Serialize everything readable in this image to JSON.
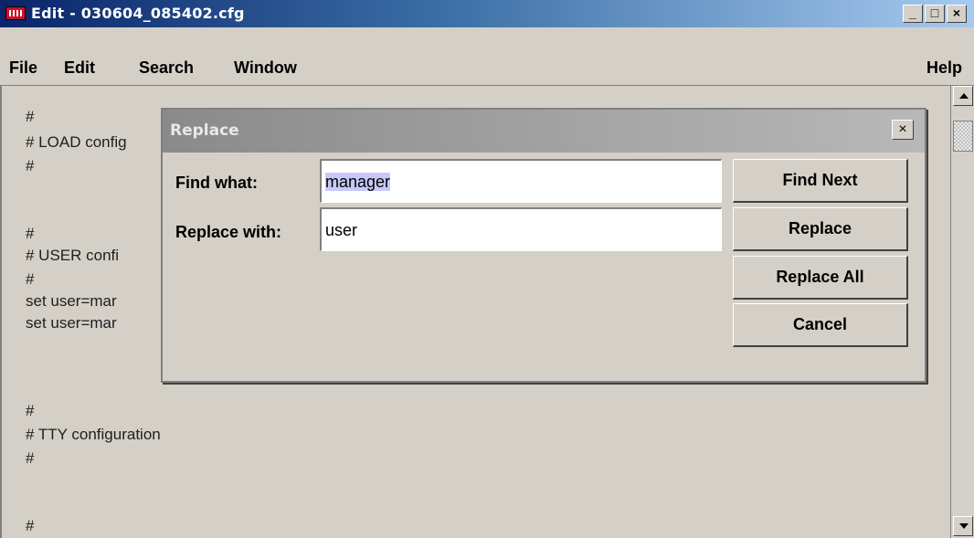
{
  "window": {
    "title": "Edit - 030604_085402.cfg",
    "minimize_label": "_",
    "maximize_label": "□",
    "close_label": "×"
  },
  "menu": {
    "file": "File",
    "edit": "Edit",
    "search": "Search",
    "window": "Window",
    "help": "Help"
  },
  "editor_lines": [
    "#",
    "# LOAD config",
    "#",
    "",
    "#",
    "# USER confi",
    "#",
    "set user=mar",
    "set user=mar",
    "",
    "#",
    "# TTY configuration",
    "#",
    "",
    "#"
  ],
  "dialog": {
    "title": "Replace",
    "close_label": "×",
    "find_label": "Find what:",
    "find_value": "manager",
    "replace_label": "Replace with:",
    "replace_value": "user",
    "buttons": {
      "find_next": "Find Next",
      "replace": "Replace",
      "replace_all": "Replace All",
      "cancel": "Cancel"
    }
  }
}
